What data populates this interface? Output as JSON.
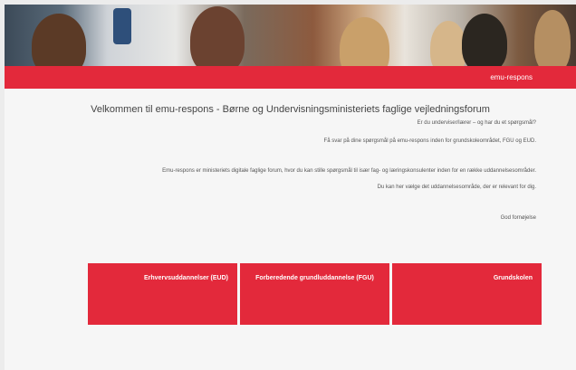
{
  "brand": {
    "accent": "#e3293b",
    "text_on_accent": "#ffffff",
    "background": "#f6f6f6"
  },
  "header": {
    "site_label": "emu-respons"
  },
  "main": {
    "title": "Velkommen til emu-respons - Børne og Undervisningsministeriets faglige vejledningsforum",
    "paragraphs": [
      "Er du underviser/lærer – og har du et spørgsmål?",
      "Få svar på dine spørgsmål på emu-respons inden for grundskoleområdet, FGU og EUD.",
      "Emu-respons er ministeriets digitale faglige forum, hvor du kan stille spørgsmål til især fag- og læringskonsulenter inden for en række uddannelsesområder.",
      "Du kan her vælge det uddannelsesområde, der er relevant for dig.",
      "God fornøjelse"
    ]
  },
  "categories": [
    {
      "label": "Grundskolen"
    },
    {
      "label": "Forberedende grundluddannelse (FGU)"
    },
    {
      "label": "Erhvervsuddannelser (EUD)"
    }
  ]
}
